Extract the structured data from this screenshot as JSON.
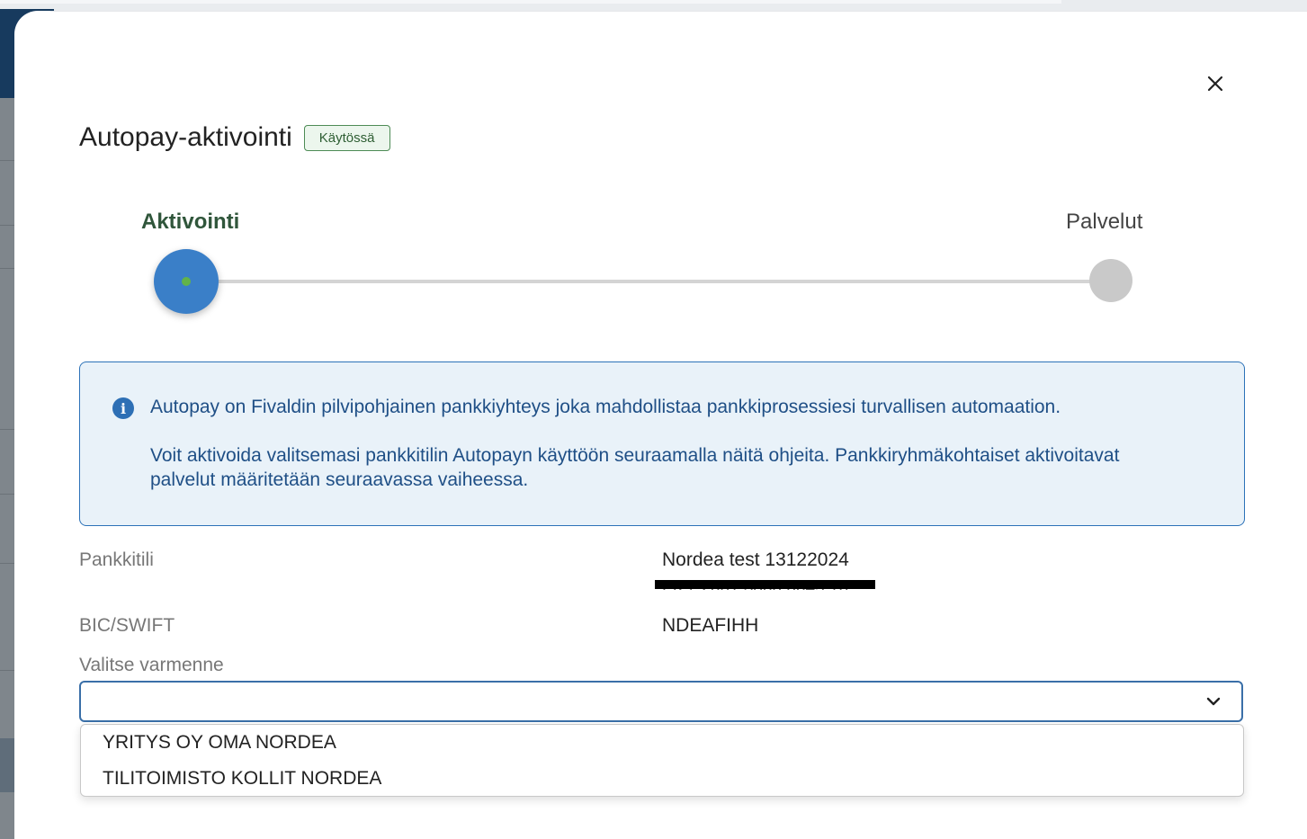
{
  "modal": {
    "title": "Autopay-aktivointi",
    "status_badge": "Käytössä",
    "close_icon": "close-icon"
  },
  "stepper": {
    "steps": [
      {
        "label": "Aktivointi",
        "state": "active"
      },
      {
        "label": "Palvelut",
        "state": "inactive"
      }
    ]
  },
  "info": {
    "icon": "info-icon",
    "paragraph1": "Autopay on Fivaldin pilvipohjainen pankkiyhteys joka mahdollistaa pankkiprosessiesi turvallisen automaation.",
    "paragraph2": "Voit aktivoida valitsemasi pankkitilin Autopayn käyttöön seuraamalla näitä ohjeita. Pankkiryhmäkohtaiset aktivoitavat palvelut määritetään seuraavassa vaiheessa."
  },
  "fields": {
    "bank_account_label": "Pankkitili",
    "bank_account_value": "Nordea test 13122024",
    "iban_value": "FI27 2061 3800 0045 16",
    "bic_label": "BIC/SWIFT",
    "bic_value": "NDEAFIHH"
  },
  "certificate_select": {
    "label": "Valitse varmenne",
    "value": "",
    "options": [
      "YRITYS OY OMA NORDEA",
      "TILITOIMISTO KOLLIT NORDEA"
    ]
  },
  "colors": {
    "accent_blue": "#3a7fc8",
    "badge_green": "#4d8b55",
    "info_bg": "#e9f2f9"
  }
}
